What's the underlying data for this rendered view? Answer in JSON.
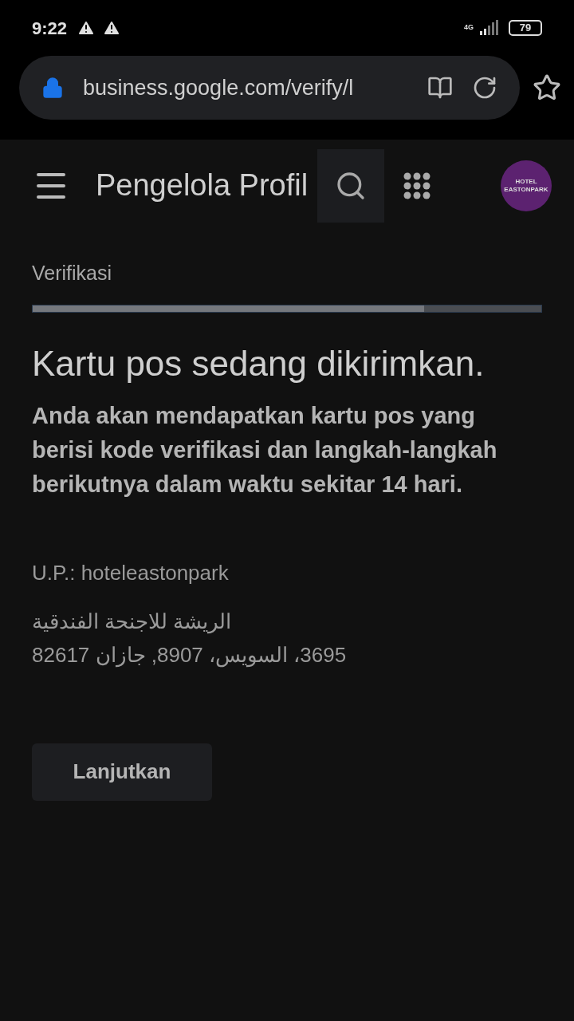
{
  "status_bar": {
    "time": "9:22",
    "network": "4G",
    "battery": "79"
  },
  "browser": {
    "url": "business.google.com/verify/l"
  },
  "app_bar": {
    "title": "Pengelola Profil",
    "avatar": {
      "line1": "HOTEL",
      "line2": "EASTONPARK"
    }
  },
  "step": {
    "label": "Verifikasi",
    "level": 0.77
  },
  "heading": "Kartu pos sedang dikirimkan.",
  "description": "Anda akan mendapatkan kartu pos yang berisi kode verifikasi dan langkah-langkah berikutnya dalam waktu sekitar 14 hari.",
  "recipient": "U.P.: hoteleastonpark",
  "address": [
    "الريشة للاجنحة الفندقية",
    "3695، السويس، 8907, جازان 82617"
  ],
  "button": "Lanjutkan"
}
